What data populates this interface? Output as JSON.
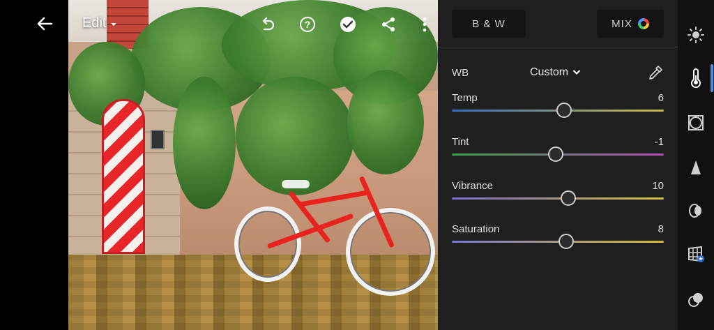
{
  "toolbar": {
    "edit_label": "Edit"
  },
  "icons": {
    "back": "back-arrow-icon",
    "edit_dropdown": "chevron-down-icon",
    "undo": "undo-icon",
    "help": "help-icon",
    "done": "checkmark-icon",
    "share": "share-icon",
    "more": "more-vertical-icon",
    "eyedropper": "eyedropper-icon",
    "rail": [
      "light-icon",
      "color-thermometer-icon",
      "effects-vignette-icon",
      "detail-icon",
      "optics-icon",
      "geometry-icon",
      "presets-icon"
    ]
  },
  "panel": {
    "bw_label": "B & W",
    "mix_label": "MIX",
    "wb_label": "WB",
    "wb_value": "Custom",
    "sliders": [
      {
        "label": "Temp",
        "value": "6",
        "position": 0.53
      },
      {
        "label": "Tint",
        "value": "-1",
        "position": 0.49
      },
      {
        "label": "Vibrance",
        "value": "10",
        "position": 0.55
      },
      {
        "label": "Saturation",
        "value": "8",
        "position": 0.54
      }
    ]
  },
  "colors": {
    "accent": "#4a90e2",
    "panel_bg": "#1f1f1f",
    "temp_track": [
      "#3a6fbf",
      "#c9b84a"
    ],
    "tint_track": [
      "#3fa14a",
      "#b04fb5"
    ],
    "vib_track": [
      "#7b6fd1",
      "#d6c43f"
    ],
    "sat_track": [
      "#7a7acf",
      "#d2b93a"
    ]
  }
}
